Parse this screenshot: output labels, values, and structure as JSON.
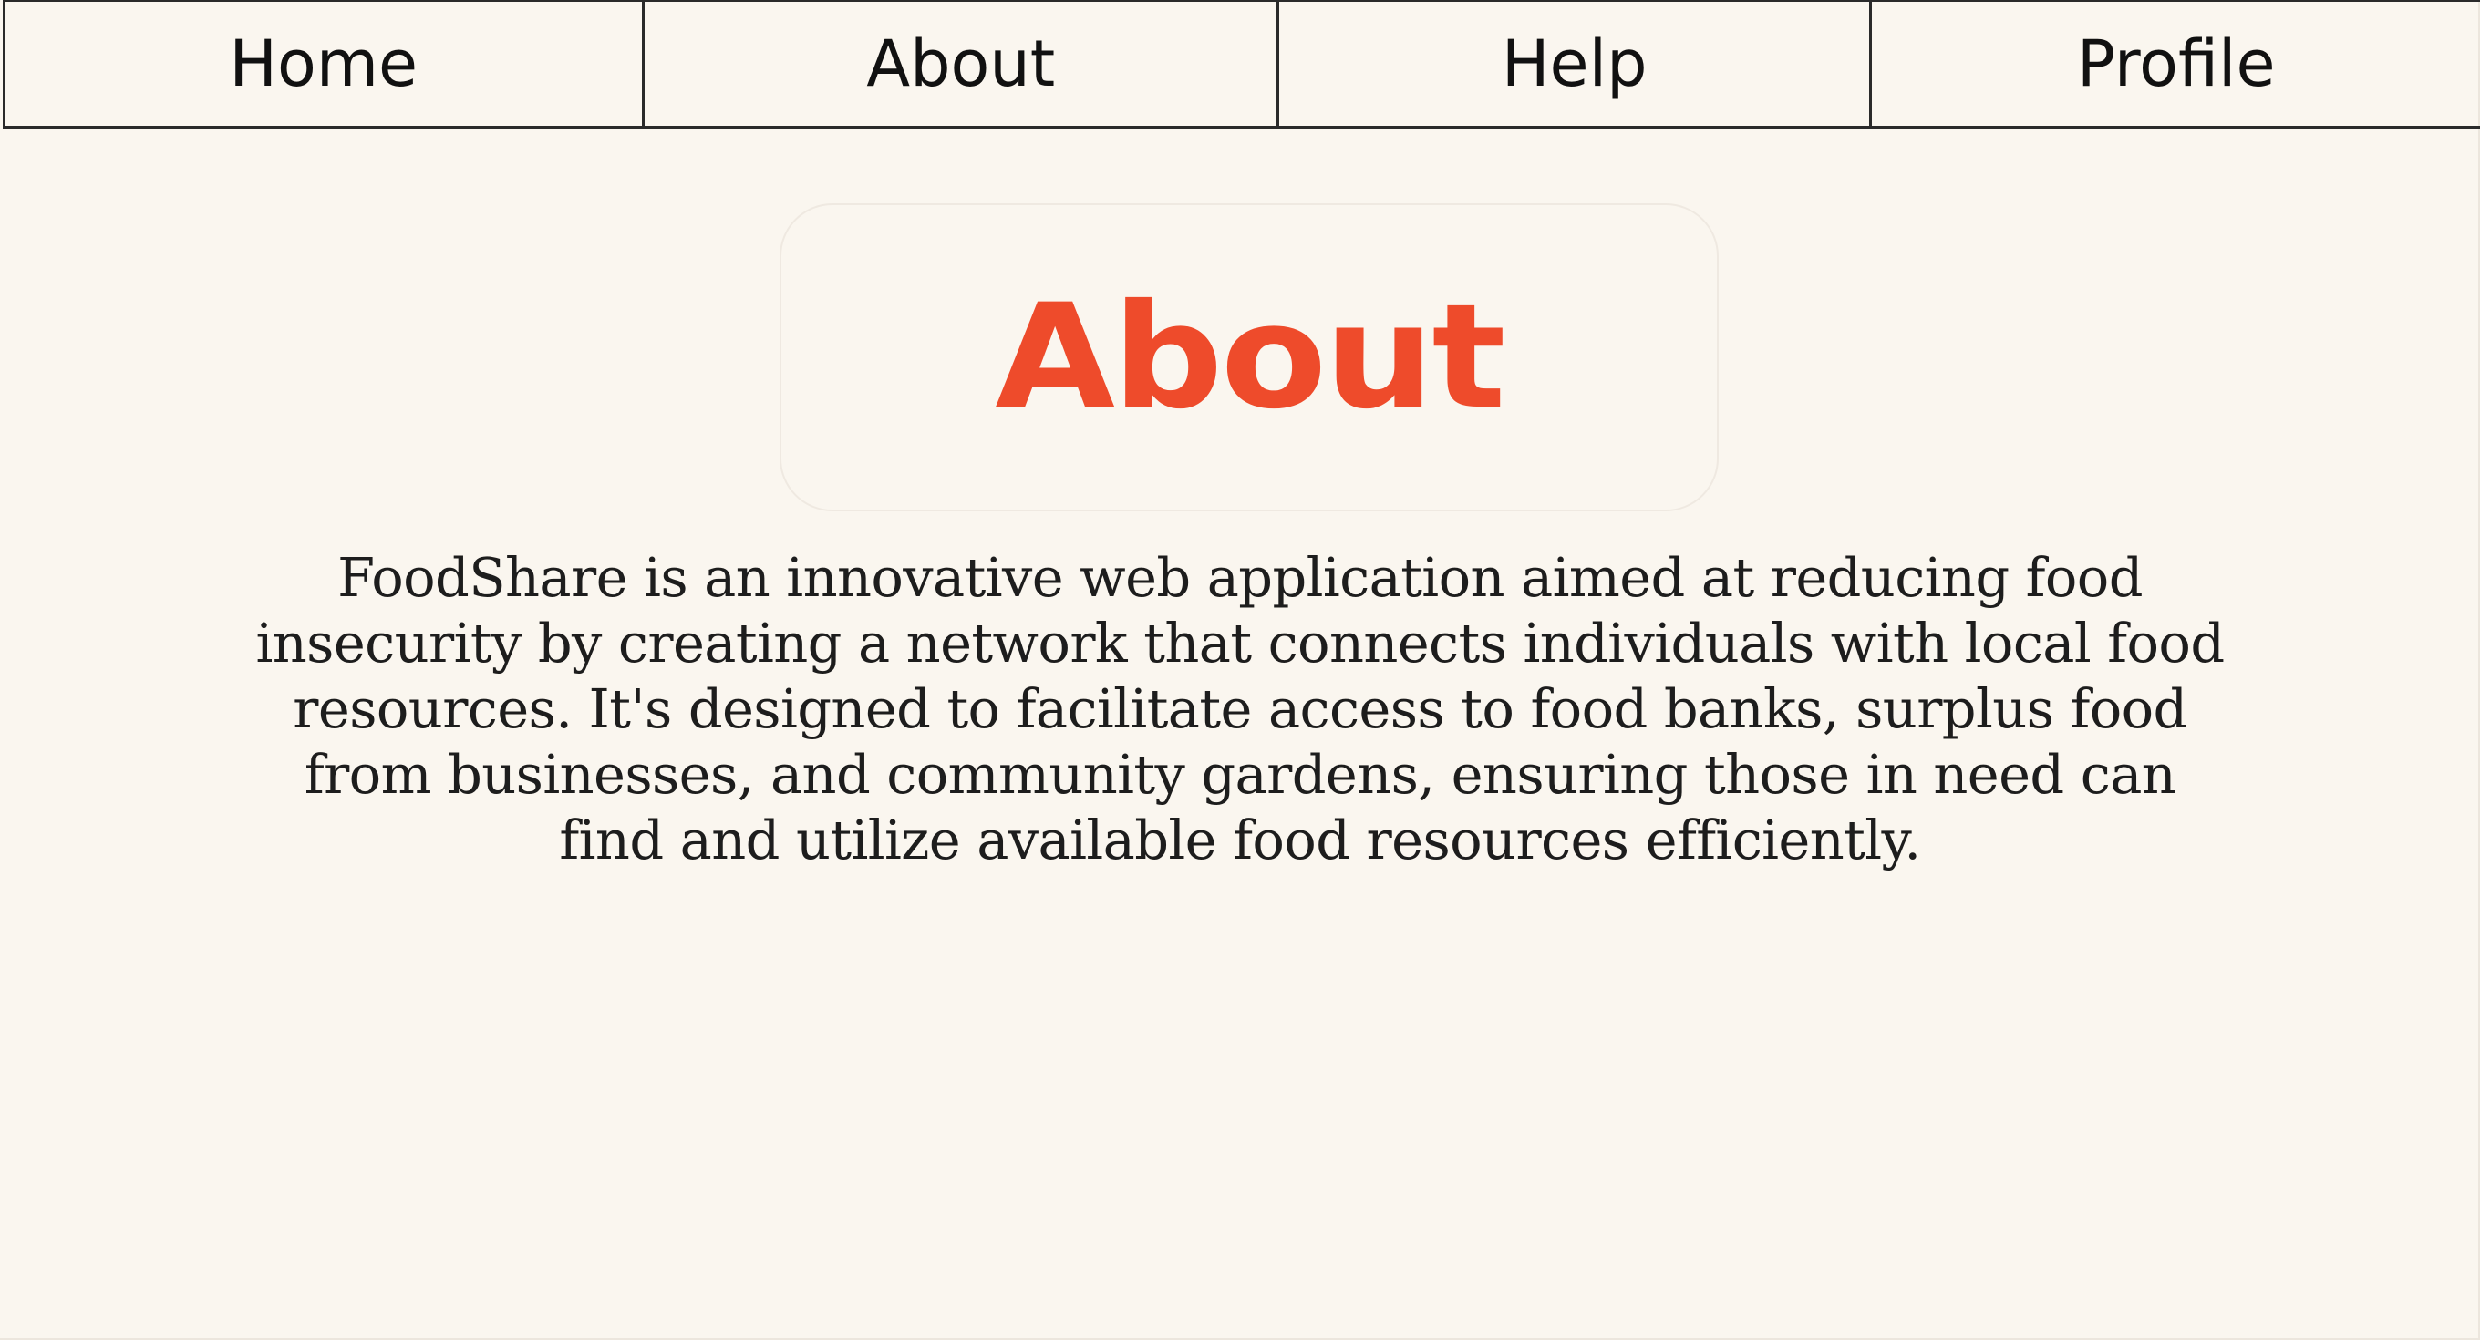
{
  "nav": {
    "items": [
      {
        "label": "Home"
      },
      {
        "label": "About"
      },
      {
        "label": "Help"
      },
      {
        "label": "Profile"
      }
    ]
  },
  "main": {
    "title": "About",
    "description": "FoodShare is an innovative web application aimed at reducing food insecurity by creating a network that connects individuals with local food resources. It's designed to facilitate access to food banks, surplus food from businesses, and community gardens, ensuring those in need can find and utilize available food resources efficiently."
  },
  "colors": {
    "background": "#faf6ef",
    "accent": "#ee4b2b",
    "text": "#1d1d1d",
    "border": "#2a2a2a"
  }
}
